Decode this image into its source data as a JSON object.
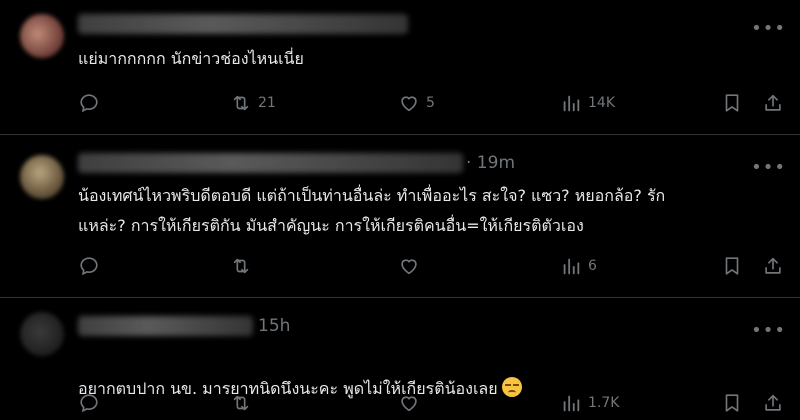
{
  "posts": [
    {
      "time": "",
      "text": "แย่มากกกกก นักข่าวช่องไหนเนี่ย",
      "replies": "",
      "reposts": "21",
      "likes": "5",
      "views": "14K",
      "more": "•••",
      "avatar_color": "#7a4a40"
    },
    {
      "time": "· 19m",
      "text": "น้องเทศน์ไหวพริบดีตอบดี แต่ถ้าเป็นท่านอื่นล่ะ ทำเพื่ออะไร สะใจ? แซว? หยอกล้อ? รัก\nแหล่ะ? การให้เกียรติกัน มันสำคัญนะ การให้เกียรติคนอื่น=ให้เกียรติตัวเอง",
      "replies": "",
      "reposts": "",
      "likes": "",
      "views": "6",
      "more": "•••",
      "avatar_color": "#9a8a6a"
    },
    {
      "time": "15h",
      "text": "อยากตบปาก นข. มารยาทนิดนึงนะคะ พูดไม่ให้เกียรติน้องเลย",
      "replies": "",
      "reposts": "",
      "likes": "",
      "views": "1.7K",
      "more": "•••",
      "avatar_color": "#3a3a3a"
    }
  ],
  "icons": {
    "reply": "reply-icon",
    "repost": "repost-icon",
    "like": "heart-icon",
    "views": "views-chart-icon",
    "bookmark": "bookmark-icon",
    "share": "share-icon"
  },
  "colors": {
    "background": "#000000",
    "text": "#e7e9ea",
    "muted": "#71767b",
    "divider": "#2f3336"
  }
}
